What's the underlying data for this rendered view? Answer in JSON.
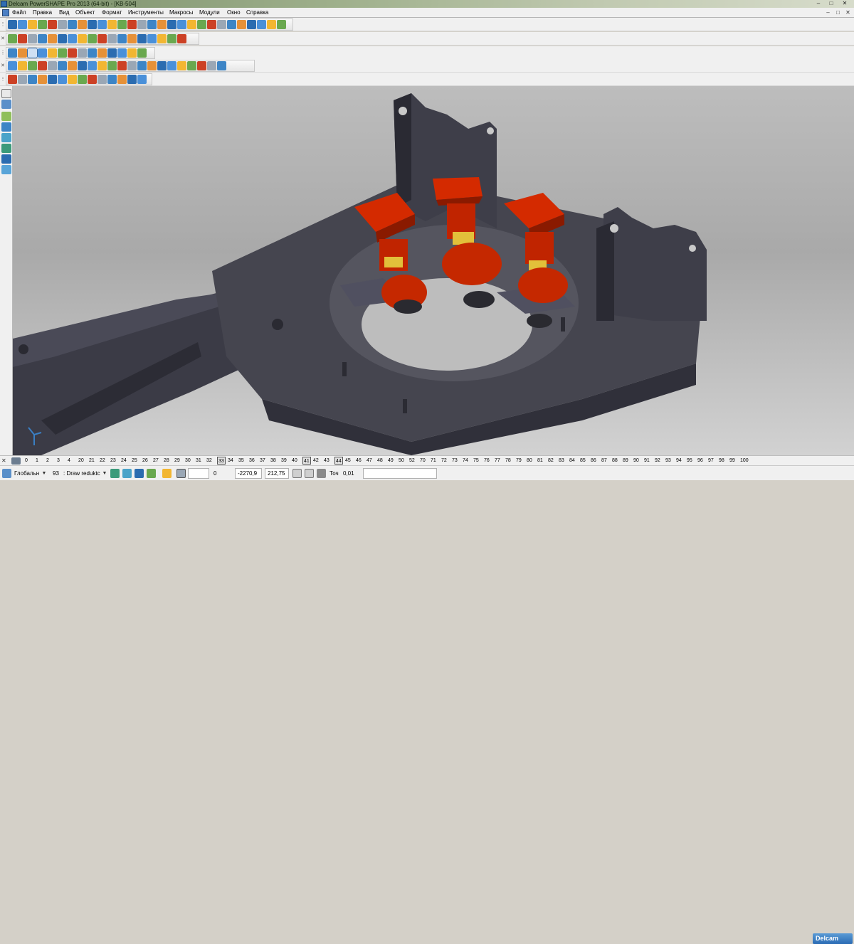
{
  "window": {
    "title": "Delcam PowerSHAPE Pro 2013 (64-bit) - [KB-504]",
    "minimize": "–",
    "maximize": "□",
    "close": "✕"
  },
  "menubar": {
    "items": [
      "Файл",
      "Правка",
      "Вид",
      "Объект",
      "Формат",
      "Инструменты",
      "Макросы",
      "Модули",
      "Окно",
      "Справка"
    ],
    "mdi_controls": [
      "–",
      "□",
      "✕"
    ]
  },
  "toolbars": {
    "grip": "✕",
    "row_colors": [
      "#2b6cb0",
      "#4a90d9",
      "#f2b632",
      "#6aa84f",
      "#cc4125",
      "#9aa7b5",
      "#3d85c6",
      "#e69138"
    ]
  },
  "workplane_bar": {
    "close": "✕",
    "levels": [
      "0",
      "1",
      "2",
      "3",
      "4",
      "20",
      "21",
      "22",
      "23",
      "24",
      "25",
      "26",
      "27",
      "28",
      "29",
      "30",
      "31",
      "32",
      "33",
      "34",
      "35",
      "36",
      "37",
      "38",
      "39",
      "40",
      "41",
      "42",
      "43",
      "44",
      "45",
      "46",
      "47",
      "48",
      "49",
      "50",
      "52",
      "70",
      "71",
      "72",
      "73",
      "74",
      "75",
      "76",
      "77",
      "78",
      "79",
      "80",
      "81",
      "82",
      "83",
      "84",
      "85",
      "86",
      "87",
      "88",
      "89",
      "90",
      "91",
      "92",
      "93",
      "94",
      "95",
      "96",
      "97",
      "98",
      "99",
      "100"
    ],
    "boxed_levels": [
      "33",
      "41",
      "44"
    ]
  },
  "statusbar": {
    "workplane": "Глобальн",
    "level_number": "93",
    "level_name": ": Draw reduktc",
    "value_zero": "0",
    "coord_x": "-2270,9",
    "coord_y": "212,75",
    "tolerance_label": "Точ",
    "tolerance_value": "0,01",
    "brand": "Delcam"
  },
  "colors": {
    "frame": "#3a3a44",
    "frame_shadow": "#2a2a32",
    "motor_red": "#d42a00",
    "motor_dark": "#8a1a00",
    "coupling_yellow": "#e2c03a"
  }
}
